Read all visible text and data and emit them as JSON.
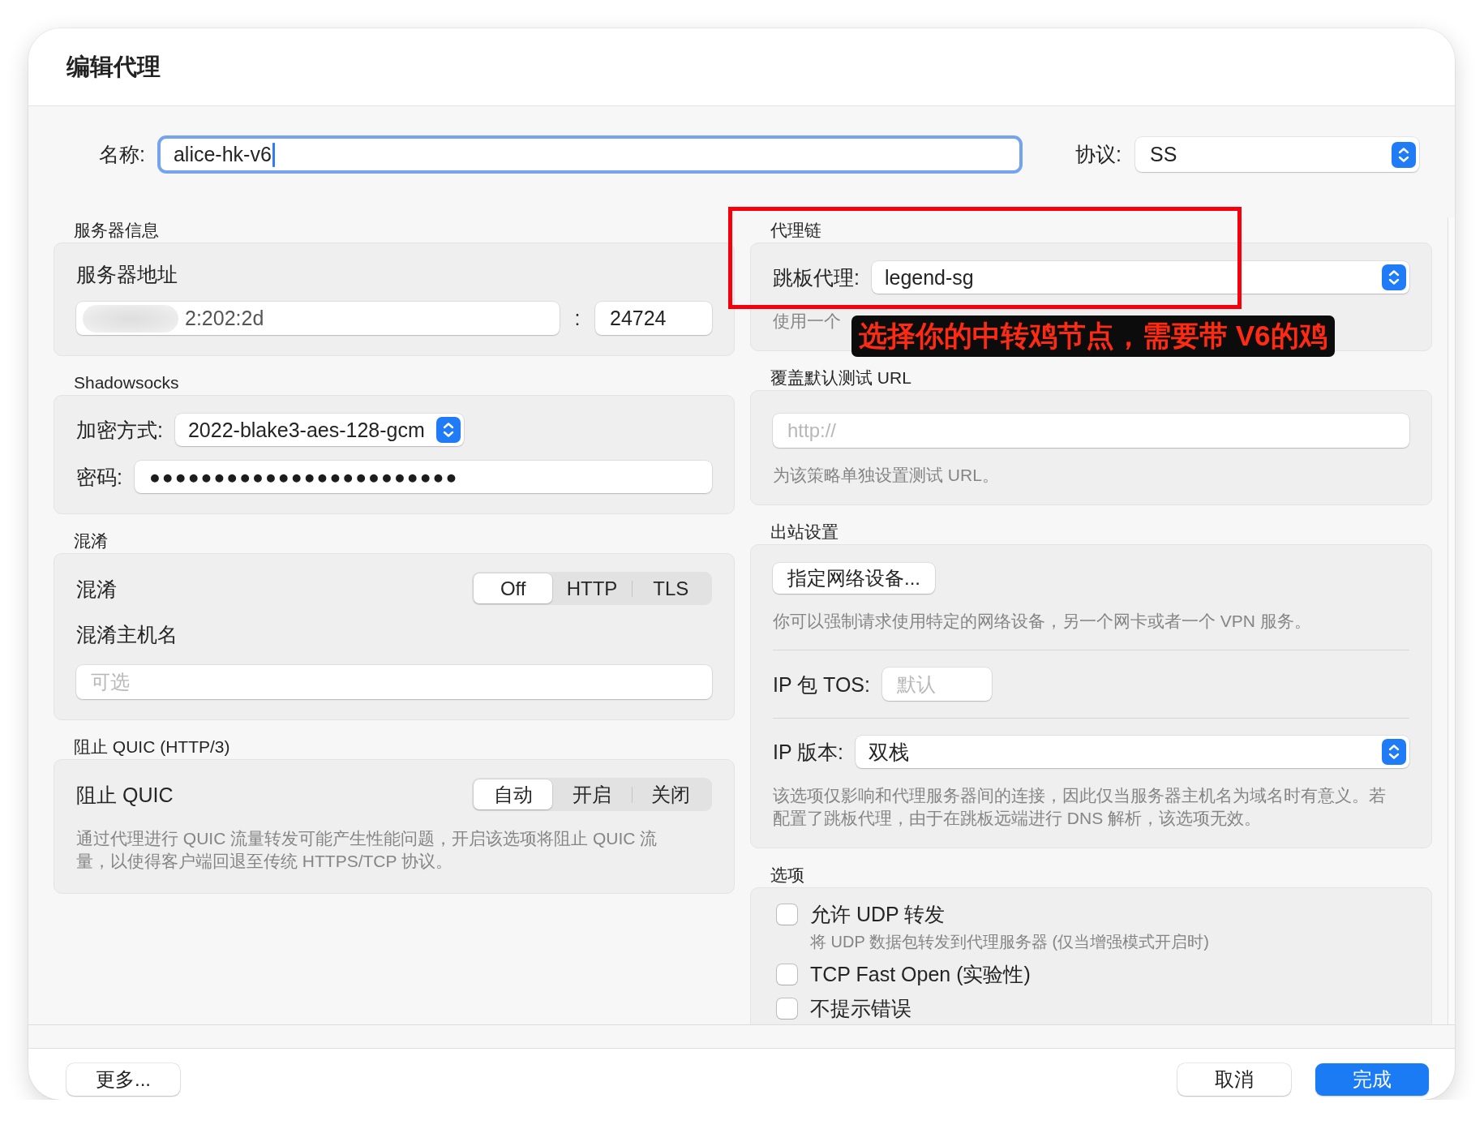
{
  "window": {
    "title": "编辑代理"
  },
  "name_row": {
    "label": "名称:",
    "value": "alice-hk-v6",
    "focused": true
  },
  "protocol": {
    "label": "协议:",
    "value": "SS"
  },
  "columns": [
    {
      "sections": [
        {
          "heading": "服务器信息",
          "rows": [
            {
              "kind": "caption",
              "text": "服务器地址"
            },
            {
              "kind": "host_port",
              "value": "2:202:2d",
              "redacted": true,
              "separator": ":",
              "port": "24724"
            }
          ]
        },
        {
          "heading": "Shadowsocks",
          "rows": [
            {
              "kind": "compact_popup",
              "label": "加密方式:",
              "value": "2022-blake3-aes-128-gcm"
            },
            {
              "kind": "secure_field",
              "label": "密码:",
              "value": "●●●●●●●●●●●●●●●●●●●●●●●●"
            }
          ]
        },
        {
          "heading": "混淆",
          "rows": [
            {
              "kind": "segmented",
              "label": "混淆",
              "options": [
                {
                  "label": "Off",
                  "selected": true
                },
                {
                  "label": "HTTP",
                  "selected": false
                },
                {
                  "label": "TLS",
                  "selected": false
                }
              ]
            },
            {
              "kind": "caption",
              "text": "混淆主机名"
            },
            {
              "kind": "text_field",
              "placeholder": "可选"
            }
          ]
        },
        {
          "heading": "阻止 QUIC (HTTP/3)",
          "rows": [
            {
              "kind": "segmented",
              "label": "阻止 QUIC",
              "options": [
                {
                  "label": "自动",
                  "selected": true
                },
                {
                  "label": "开启",
                  "selected": false
                },
                {
                  "label": "关闭",
                  "selected": false
                }
              ]
            },
            {
              "kind": "note",
              "text": "通过代理进行 QUIC 流量转发可能产生性能问题，开启该选项将阻止 QUIC 流量，以使得客户端回退至传统 HTTPS/TCP 协议。"
            }
          ]
        }
      ]
    },
    {
      "sections": [
        {
          "heading": "代理链",
          "rows": [
            {
              "kind": "popup",
              "label": "跳板代理:",
              "value": "legend-sg"
            },
            {
              "kind": "note",
              "text": "使用一个"
            }
          ]
        },
        {
          "heading": "覆盖默认测试 URL",
          "rows": [
            {
              "kind": "text_field",
              "placeholder": "http://"
            },
            {
              "kind": "note",
              "text": "为该策略单独设置测试 URL。"
            }
          ]
        },
        {
          "heading": "出站设置",
          "rows": [
            {
              "kind": "button",
              "label": "指定网络设备..."
            },
            {
              "kind": "note",
              "text": "你可以强制请求使用特定的网络设备，另一个网卡或者一个 VPN 服务。"
            },
            {
              "kind": "divider"
            },
            {
              "kind": "short_field",
              "label": "IP 包 TOS:",
              "placeholder": "默认"
            },
            {
              "kind": "divider"
            },
            {
              "kind": "popup",
              "label": "IP 版本:",
              "value": "双栈"
            },
            {
              "kind": "note",
              "text": "该选项仅影响和代理服务器间的连接，因此仅当服务器主机名为域名时有意义。若配置了跳板代理，由于在跳板远端进行 DNS 解析，该选项无效。"
            }
          ]
        },
        {
          "heading": "选项",
          "rows": [
            {
              "kind": "checkbox",
              "label": "允许 UDP 转发",
              "checked": false,
              "note": "将 UDP 数据包转发到代理服务器 (仅当增强模式开启时)"
            },
            {
              "kind": "checkbox",
              "label": "TCP Fast Open (实验性)",
              "checked": false
            },
            {
              "kind": "checkbox",
              "label": "不提示错误",
              "checked": false
            }
          ]
        }
      ]
    }
  ],
  "annotation": {
    "frame": true,
    "callout": "选择你的中转鸡节点，需要带 V6的鸡"
  },
  "footer": {
    "left_buttons": [
      {
        "label": "更多...",
        "kind": "plain"
      }
    ],
    "right_buttons": [
      {
        "label": "取消",
        "kind": "plain"
      },
      {
        "label": "完成",
        "kind": "default"
      }
    ]
  }
}
